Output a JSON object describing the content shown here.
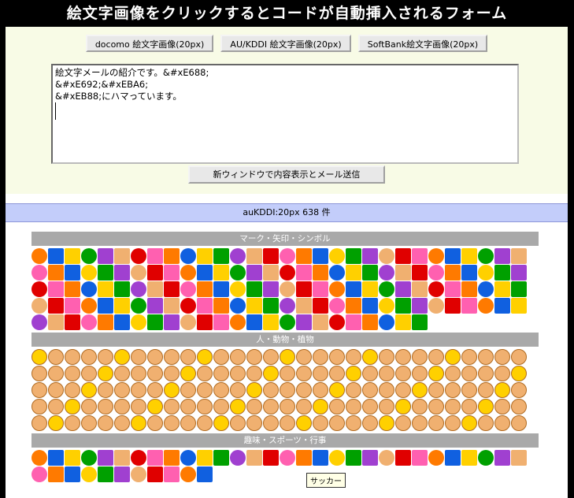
{
  "page": {
    "title": "絵文字画像をクリックするとコードが自動挿入されるフォーム"
  },
  "tabs": [
    {
      "label": "docomo 絵文字画像(20px)"
    },
    {
      "label": "AU/KDDI 絵文字画像(20px)"
    },
    {
      "label": "SoftBank絵文字画像(20px)"
    }
  ],
  "form": {
    "textarea_lines": [
      "絵文字メールの紹介です。&#xE688;",
      "&#xE692;&#xEBA6;",
      "&#xEB88;にハマっています。"
    ],
    "submit_label": "新ウィンドウで内容表示とメール送信"
  },
  "list": {
    "summary": "auKDDI:20px 638 件"
  },
  "categories": [
    {
      "label": "マーク・矢印・シンボル"
    },
    {
      "label": "人・動物・植物"
    },
    {
      "label": "趣味・スポーツ・行事"
    }
  ],
  "tooltip": "サッカー",
  "palette": {
    "orange": "#ff7a00",
    "green": "#00a000",
    "red": "#e00000",
    "blue": "#1060e0",
    "purple": "#a040d0",
    "pink": "#ff60b0",
    "yellow": "#ffd000",
    "tan": "#f0b070",
    "black": "#111111"
  }
}
